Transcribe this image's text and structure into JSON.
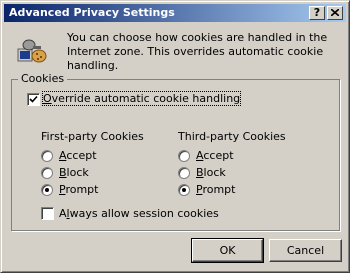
{
  "dialog": {
    "title": "Advanced Privacy Settings",
    "help_button": "?",
    "close_button": "x",
    "intro_text": "You can choose how cookies are handled in the Internet zone.  This overrides automatic cookie handling.",
    "intro_icon": "cookie-settings-icon"
  },
  "cookies_group": {
    "label": "Cookies",
    "override": {
      "label": "Override automatic cookie handling",
      "checked": true
    },
    "first_party": {
      "heading": "First-party Cookies",
      "options": [
        "Accept",
        "Block",
        "Prompt"
      ],
      "selected": "Prompt"
    },
    "third_party": {
      "heading": "Third-party Cookies",
      "options": [
        "Accept",
        "Block",
        "Prompt"
      ],
      "selected": "Prompt"
    },
    "session": {
      "label": "Always allow session cookies",
      "checked": false
    }
  },
  "buttons": {
    "ok": "OK",
    "cancel": "Cancel"
  }
}
